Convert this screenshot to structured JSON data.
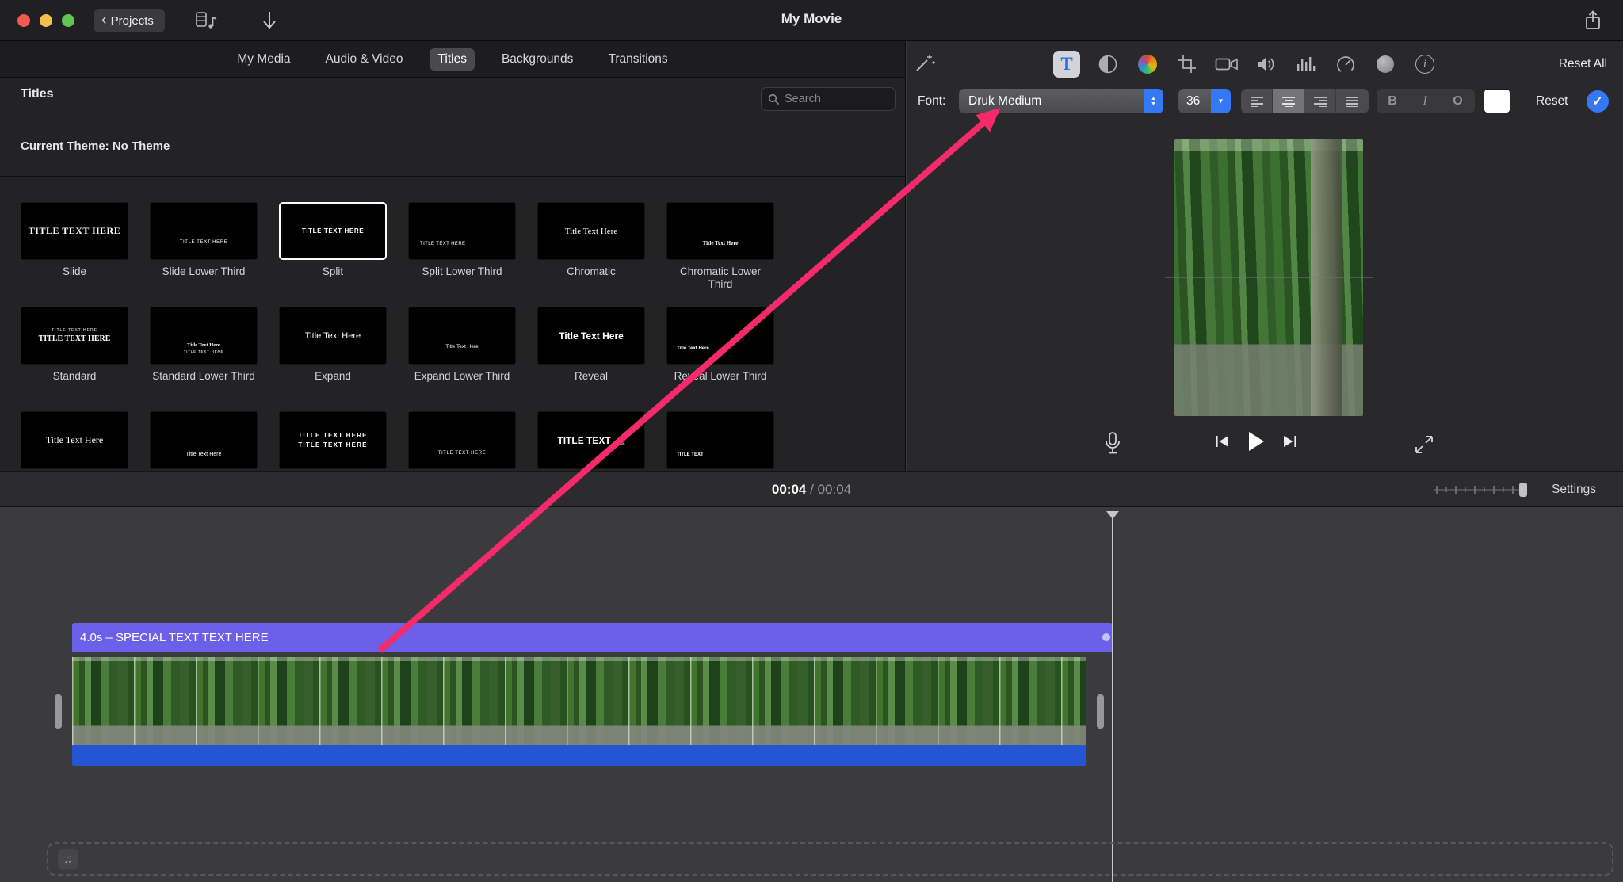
{
  "colors": {
    "accent_blue": "#3478f6",
    "arrow_pink": "#f42a6a",
    "clip_purple": "#6d60e8",
    "clip_blue": "#2456d4",
    "selected_text_tool": "#1f6ef0"
  },
  "titlebar": {
    "projects_label": "Projects",
    "back_chevron": "‹",
    "window_title": "My Movie"
  },
  "media_tabs": {
    "items": [
      {
        "label": "My Media"
      },
      {
        "label": "Audio & Video"
      },
      {
        "label": "Titles"
      },
      {
        "label": "Backgrounds"
      },
      {
        "label": "Transitions"
      }
    ],
    "selected": "Titles"
  },
  "titles_panel": {
    "header": "Titles",
    "search_placeholder": "Search",
    "current_theme": "Current Theme: No Theme",
    "items": [
      {
        "preview": "TITLE TEXT HERE",
        "label": "Slide"
      },
      {
        "preview": "TITLE TEXT HERE",
        "label": "Slide Lower Third"
      },
      {
        "preview": "TITLE TEXT HERE",
        "label": "Split",
        "selected": true
      },
      {
        "preview": "TITLE TEXT HERE",
        "label": "Split Lower Third"
      },
      {
        "preview": "Title Text Here",
        "label": "Chromatic"
      },
      {
        "preview": "Title Text Here",
        "label": "Chromatic Lower Third"
      },
      {
        "preview": "TITLE TEXT HERE",
        "sub": "TITLE TEXT HERE",
        "label": "Standard"
      },
      {
        "preview": "Title Text Here",
        "sub": "TITLE TEXT HERE",
        "label": "Standard Lower Third"
      },
      {
        "preview": "Title Text Here",
        "label": "Expand"
      },
      {
        "preview": "Title Text Here",
        "label": "Expand Lower Third"
      },
      {
        "preview": "Title Text Here",
        "label": "Reveal"
      },
      {
        "preview": "Title Text Here",
        "label": "Reveal Lower Third"
      },
      {
        "preview": "Title Text Here",
        "label": ""
      },
      {
        "preview": "Title Text Here",
        "label": ""
      },
      {
        "preview": "TITLE TEXT HERE",
        "sub": "TITLE TEXT HERE",
        "label": ""
      },
      {
        "preview": "TITLE TEXT HERE",
        "label": ""
      },
      {
        "preview": "TITLE TEXT",
        "sub": "HERE",
        "label": ""
      },
      {
        "preview": "TITLE TEXT",
        "label": ""
      }
    ]
  },
  "inspector": {
    "reset_all": "Reset All",
    "font_label": "Font:",
    "font_value": "Druk Medium",
    "size_value": "36",
    "bold": "B",
    "italic": "I",
    "outline": "O",
    "reset": "Reset"
  },
  "glyphs": {
    "text_tool": "T",
    "info": "i",
    "check": "✓",
    "music_note": "♫",
    "chevron_up": "▲",
    "chevron_down": "▼"
  },
  "timeline_toolbar": {
    "current_time": "00:04",
    "separator": "/",
    "total_time": "00:04",
    "settings": "Settings"
  },
  "timeline": {
    "title_clip_label": "4.0s – SPECIAL TEXT TEXT HERE"
  }
}
